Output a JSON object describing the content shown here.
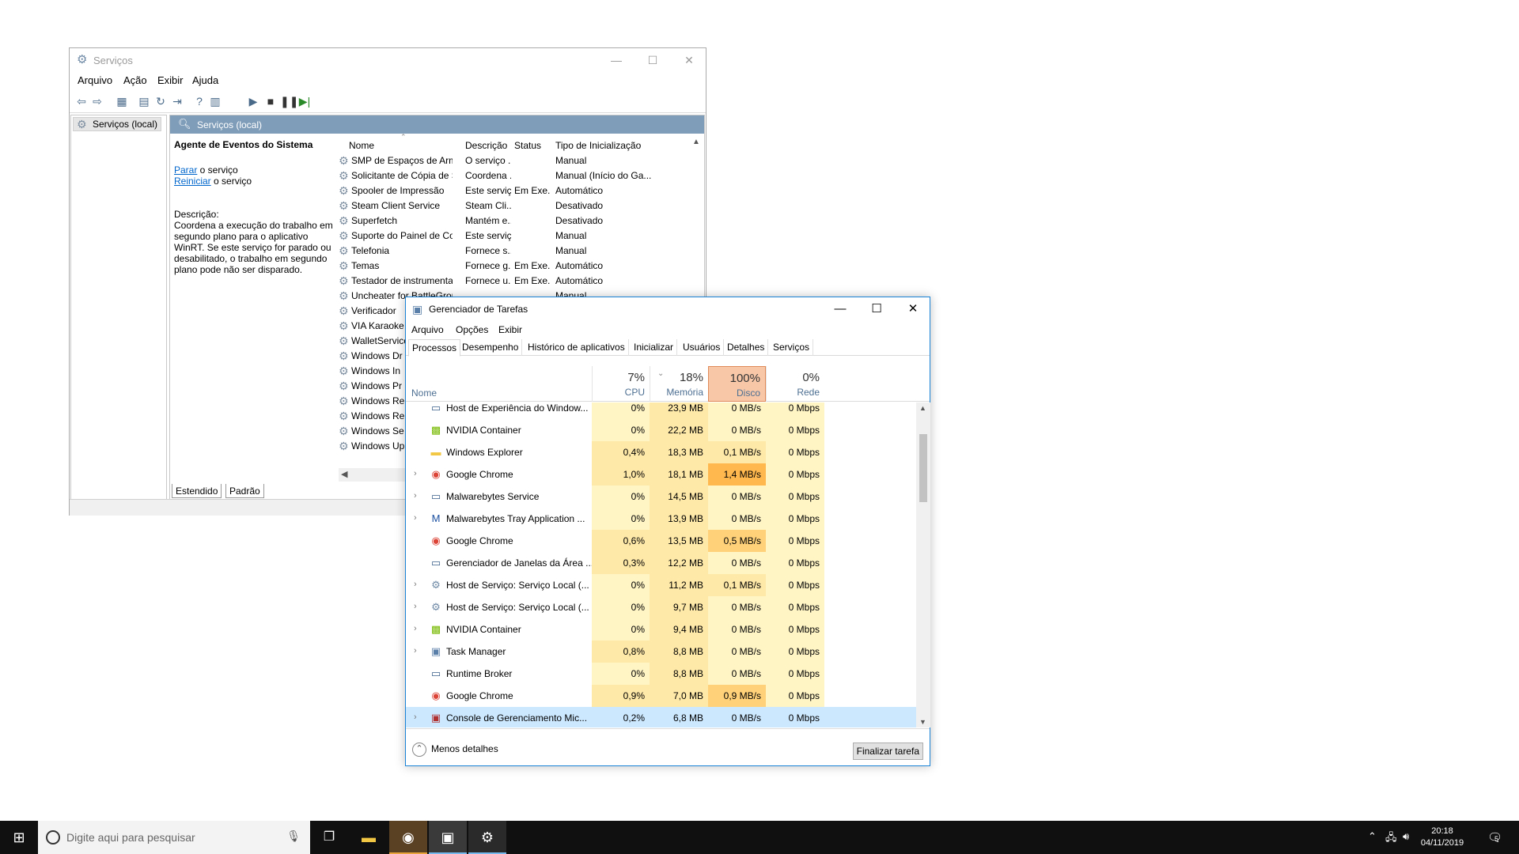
{
  "services_window": {
    "title": "Serviços",
    "menu": [
      "Arquivo",
      "Ação",
      "Exibir",
      "Ajuda"
    ],
    "tree_item": "Serviços (local)",
    "header": "Serviços (local)",
    "selected_service": "Agente de Eventos do Sistema",
    "stop_link": "Parar",
    "stop_suffix": " o serviço",
    "restart_link": "Reiniciar",
    "restart_suffix": " o serviço",
    "description_label": "Descrição:",
    "description": "Coordena a execução do trabalho em segundo plano para o aplicativo WinRT. Se este serviço for parado ou desabilitado, o trabalho em segundo plano pode não ser disparado.",
    "columns": {
      "name": "Nome",
      "description": "Descrição",
      "status": "Status",
      "startup": "Tipo de Inicialização"
    },
    "rows": [
      {
        "name": "SMP de Espaços de Armaze...",
        "desc": "O serviço ...",
        "status": "",
        "startup": "Manual"
      },
      {
        "name": "Solicitante de Cópia de So...",
        "desc": "Coordena ...",
        "status": "",
        "startup": "Manual (Início do Ga..."
      },
      {
        "name": "Spooler de Impressão",
        "desc": "Este serviç...",
        "status": "Em Exe...",
        "startup": "Automático"
      },
      {
        "name": "Steam Client Service",
        "desc": "Steam Cli...",
        "status": "",
        "startup": "Desativado"
      },
      {
        "name": "Superfetch",
        "desc": "Mantém e...",
        "status": "",
        "startup": "Desativado"
      },
      {
        "name": "Suporte do Painel de Contr...",
        "desc": "Este serviç...",
        "status": "",
        "startup": "Manual"
      },
      {
        "name": "Telefonia",
        "desc": "Fornece s...",
        "status": "",
        "startup": "Manual"
      },
      {
        "name": "Temas",
        "desc": "Fornece g...",
        "status": "Em Exe...",
        "startup": "Automático"
      },
      {
        "name": "Testador de instrumentaçã...",
        "desc": "Fornece u...",
        "status": "Em Exe...",
        "startup": "Automático"
      },
      {
        "name": "Uncheater for BattleGround",
        "desc": "",
        "status": "",
        "startup": "Manual"
      },
      {
        "name": "Verificador",
        "desc": "",
        "status": "",
        "startup": ""
      },
      {
        "name": "VIA Karaoke",
        "desc": "",
        "status": "",
        "startup": ""
      },
      {
        "name": "WalletService",
        "desc": "",
        "status": "",
        "startup": ""
      },
      {
        "name": "Windows Dr",
        "desc": "",
        "status": "",
        "startup": ""
      },
      {
        "name": "Windows In",
        "desc": "",
        "status": "",
        "startup": ""
      },
      {
        "name": "Windows Pr",
        "desc": "",
        "status": "",
        "startup": ""
      },
      {
        "name": "Windows Re",
        "desc": "",
        "status": "",
        "startup": ""
      },
      {
        "name": "Windows Re",
        "desc": "",
        "status": "",
        "startup": ""
      },
      {
        "name": "Windows Se",
        "desc": "",
        "status": "",
        "startup": ""
      },
      {
        "name": "Windows Up",
        "desc": "",
        "status": "",
        "startup": ""
      }
    ],
    "bottom_tabs": [
      "Estendido",
      "Padrão"
    ]
  },
  "task_manager": {
    "title": "Gerenciador de Tarefas",
    "menu": [
      "Arquivo",
      "Opções",
      "Exibir"
    ],
    "tabs": [
      "Processos",
      "Desempenho",
      "Histórico de aplicativos",
      "Inicializar",
      "Usuários",
      "Detalhes",
      "Serviços"
    ],
    "name_column": "Nome",
    "columns": [
      {
        "pct": "7%",
        "label": "CPU"
      },
      {
        "pct": "18%",
        "label": "Memória"
      },
      {
        "pct": "100%",
        "label": "Disco"
      },
      {
        "pct": "0%",
        "label": "Rede"
      }
    ],
    "processes": [
      {
        "name": "Host de Experiência do Window...",
        "icon": "window-icon",
        "expand": false,
        "cpu": "0%",
        "mem": "23,9 MB",
        "disk": "0 MB/s",
        "net": "0 Mbps"
      },
      {
        "name": "NVIDIA Container",
        "icon": "nvidia-icon",
        "expand": false,
        "cpu": "0%",
        "mem": "22,2 MB",
        "disk": "0 MB/s",
        "net": "0 Mbps"
      },
      {
        "name": "Windows Explorer",
        "icon": "folder-icon",
        "expand": false,
        "cpu": "0,4%",
        "mem": "18,3 MB",
        "disk": "0,1 MB/s",
        "net": "0 Mbps"
      },
      {
        "name": "Google Chrome",
        "icon": "chrome-icon",
        "expand": true,
        "cpu": "1,0%",
        "mem": "18,1 MB",
        "disk": "1,4 MB/s",
        "net": "0 Mbps"
      },
      {
        "name": "Malwarebytes Service",
        "icon": "window-icon",
        "expand": true,
        "cpu": "0%",
        "mem": "14,5 MB",
        "disk": "0 MB/s",
        "net": "0 Mbps"
      },
      {
        "name": "Malwarebytes Tray Application ...",
        "icon": "malwarebytes-icon",
        "expand": true,
        "cpu": "0%",
        "mem": "13,9 MB",
        "disk": "0 MB/s",
        "net": "0 Mbps"
      },
      {
        "name": "Google Chrome",
        "icon": "chrome-icon",
        "expand": false,
        "cpu": "0,6%",
        "mem": "13,5 MB",
        "disk": "0,5 MB/s",
        "net": "0 Mbps"
      },
      {
        "name": "Gerenciador de Janelas da Área ...",
        "icon": "window-icon",
        "expand": false,
        "cpu": "0,3%",
        "mem": "12,2 MB",
        "disk": "0 MB/s",
        "net": "0 Mbps"
      },
      {
        "name": "Host de Serviço: Serviço Local (...",
        "icon": "gear-icon",
        "expand": true,
        "cpu": "0%",
        "mem": "11,2 MB",
        "disk": "0,1 MB/s",
        "net": "0 Mbps"
      },
      {
        "name": "Host de Serviço: Serviço Local (...",
        "icon": "gear-icon",
        "expand": true,
        "cpu": "0%",
        "mem": "9,7 MB",
        "disk": "0 MB/s",
        "net": "0 Mbps"
      },
      {
        "name": "NVIDIA Container",
        "icon": "nvidia-icon",
        "expand": true,
        "cpu": "0%",
        "mem": "9,4 MB",
        "disk": "0 MB/s",
        "net": "0 Mbps"
      },
      {
        "name": "Task Manager",
        "icon": "taskmanager-icon",
        "expand": true,
        "cpu": "0,8%",
        "mem": "8,8 MB",
        "disk": "0 MB/s",
        "net": "0 Mbps"
      },
      {
        "name": "Runtime Broker",
        "icon": "window-icon",
        "expand": false,
        "cpu": "0%",
        "mem": "8,8 MB",
        "disk": "0 MB/s",
        "net": "0 Mbps"
      },
      {
        "name": "Google Chrome",
        "icon": "chrome-icon",
        "expand": false,
        "cpu": "0,9%",
        "mem": "7,0 MB",
        "disk": "0,9 MB/s",
        "net": "0 Mbps"
      },
      {
        "name": "Console de Gerenciamento Mic...",
        "icon": "mmc-icon",
        "expand": true,
        "cpu": "0,2%",
        "mem": "6,8 MB",
        "disk": "0 MB/s",
        "net": "0 Mbps",
        "selected": true
      }
    ],
    "fewer_details": "Menos detalhes",
    "end_task": "Finalizar tarefa"
  },
  "taskbar": {
    "search_placeholder": "Digite aqui para pesquisar",
    "time": "20:18",
    "date": "04/11/2019",
    "notification_count": "5"
  }
}
